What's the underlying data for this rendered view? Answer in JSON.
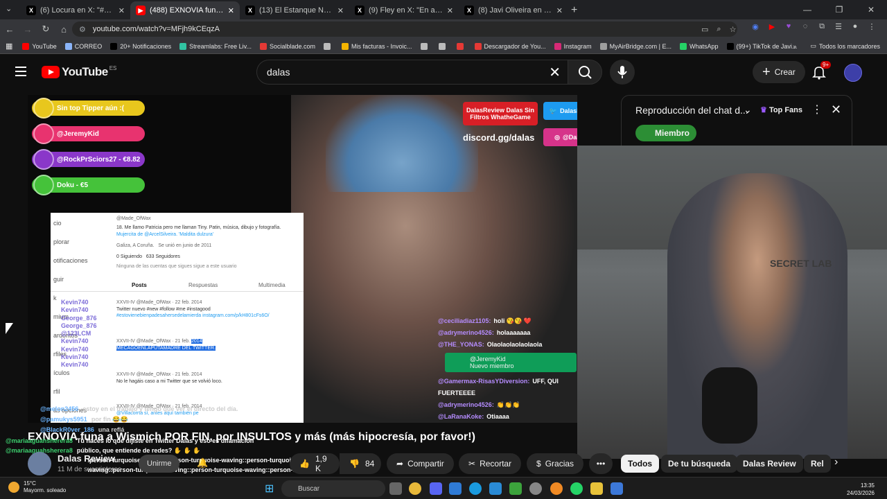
{
  "browser": {
    "tabs": [
      {
        "label": "(6) Locura en X: \"#CárcelGemel",
        "favicon": "X",
        "color": "#000"
      },
      {
        "label": "(488) EXNOVIA funa a Wismich",
        "favicon": "▶",
        "color": "#ff0000"
      },
      {
        "label": "(13) El Estanque News en X:",
        "favicon": "X",
        "color": "#000"
      },
      {
        "label": "(9) Fley en X: \"En algunos afirm",
        "favicon": "X",
        "color": "#000"
      },
      {
        "label": "(8) Javi Oliveira en X: \"Una ex p",
        "favicon": "X",
        "color": "#000"
      }
    ],
    "new_tab": "+",
    "url": "youtube.com/watch?v=MFjh9kCEqzA",
    "bookmarks": [
      {
        "label": "YouTube",
        "color": "#ff0000"
      },
      {
        "label": "CORREO",
        "color": "#8ab4f8"
      },
      {
        "label": "20+ Notificaciones",
        "color": "#000000"
      },
      {
        "label": "Streamlabs: Free Liv...",
        "color": "#31c3a2"
      },
      {
        "label": "Socialblade.com",
        "color": "#e53935"
      },
      {
        "label": "",
        "color": "#bbbbbb"
      },
      {
        "label": "Mis facturas - Invoic...",
        "color": "#f4b400"
      },
      {
        "label": "",
        "color": "#bbbbbb"
      },
      {
        "label": "",
        "color": "#bbbbbb"
      },
      {
        "label": "",
        "color": "#e53935"
      },
      {
        "label": "Descargador de You...",
        "color": "#e53935"
      },
      {
        "label": "Instagram",
        "color": "#d62976"
      },
      {
        "label": "MyAirBridge.com | E...",
        "color": "#9e9e9e"
      },
      {
        "label": "WhatsApp",
        "color": "#25d366"
      },
      {
        "label": "(99+) TikTok de Javi...",
        "color": "#000000"
      }
    ],
    "bookmarks_more": "»",
    "all_bookmarks": "Todos los marcadores"
  },
  "youtube": {
    "logo_text": "YouTube",
    "region": "ES",
    "search_value": "dalas",
    "create_label": "Crear",
    "notif_badge": "9+"
  },
  "video": {
    "overlay_alerts": [
      {
        "text": "Sin top Tipper aún :(",
        "color": "#e8c71d"
      },
      {
        "text": "@JeremyKid",
        "color": "#e8336f"
      },
      {
        "text": "@RockPrSciors27 - €8.82",
        "color": "#8a37c9"
      },
      {
        "text": "Doku - €5",
        "color": "#45c23a"
      }
    ],
    "socials": {
      "dalas_review": "DalasReview Dalas Sin Filtros WhatheGame",
      "twitter": "DalasReview",
      "discord": "discord.gg/dalas",
      "instagram": "@Dalasito"
    },
    "tweet_panel": {
      "handle": "@Made_OfWax",
      "bio_line1": "18. Me llamo Patricia pero me llaman Tiny. Patin, música, dibujo y fotografía.",
      "bio_line2": "Mujercita de @ArcelSilveira. 'Maldita dulzura'",
      "location": "Galiza, A Coruña.",
      "joined": "Se unió en junio de 2011",
      "following": "0 Siguiendo",
      "followers": "633 Seguidores",
      "nobody": "Ninguna de las cuentas que sigues sigue a este usuario",
      "tab_posts": "Posts",
      "tab_replies": "Respuestas",
      "tab_media": "Multimedia",
      "t1_head": "XXVII-IV @Made_OfWax · 22 feb. 2014",
      "t1_text": "Twitter nuevo #new #follow #me #instagood",
      "t1_text2": "#estovienebienpadesahersedelamierda instagram.com/p/kH801cFs6O/",
      "t2_head": "XXVII-IV @Made_OfWax · 21 feb.",
      "t2_year": "2014",
      "t2_text": "MECAGOENLAPUTAMADRE DEL TWITTER.",
      "t3_head": "XXVII-IV @Made_OfWax · 21 feb. 2014",
      "t3_text": "No le hagáis caso a mi Twitter que se volvió loco.",
      "t4_head": "XXVII-IV @Made_OfWax · 21 feb. 2014",
      "t4_text": "@Villacorrta sí, antes aquí también pe",
      "side_labels": [
        "cio",
        "plorar",
        "otificaciones",
        "guir",
        "k",
        "mium",
        "ardoritos",
        "rfiles",
        "ículos",
        "rfil",
        "ás opciones"
      ]
    },
    "kevin_list": [
      "Kevin740",
      "Kevin740",
      "George_876",
      "George_876",
      "@123LCM",
      "Kevin740",
      "Kevin740",
      "Kevin740",
      "Kevin740"
    ],
    "overlay_chat": [
      {
        "user": "@ceciliadiaz1105:",
        "msg": "holi 😘😘 ❤️"
      },
      {
        "user": "@adrymerino4526:",
        "msg": "holaaaaaaa"
      },
      {
        "user": "@THE_YONAS:",
        "msg": "Olaolaolaolaolaola"
      },
      {
        "user": "@Gamermax-RisasYDiversion:",
        "msg": "UFF, QUI FUERTEEEE"
      },
      {
        "user": "@adrymerino4526:",
        "msg": "👏👏👏"
      },
      {
        "user": "@LaRanaKoke:",
        "msg": "Otiaaaa"
      },
      {
        "user": "@88llerrx70:",
        "msg": "Te amo dalas"
      }
    ],
    "new_member": {
      "user": "@JeremyKid",
      "label": "Nuevo miembro"
    },
    "webcam_logo": "SECRET LAB",
    "bottom_chat": [
      {
        "user": "@melon2456",
        "msg": "estoy en el trabajo y tengo que ver el directo del día."
      },
      {
        "user": "@pamukys5951",
        "msg": "por fin 😂😂"
      },
      {
        "user": "@BlackR0ver_186",
        "msg": "una reflá"
      }
    ]
  },
  "live_chat_panel": {
    "title": "Reproducción del chat d...",
    "filter": "Top Fans",
    "member_chip": "Miembro"
  },
  "video_info": {
    "title": "EXNOVIA funa a Wismich POR FIN, por INSULTOS y más (más hipocresía, por favor!)",
    "channel": "Dalas Review",
    "subs": "11 M de suscriptores",
    "join": "Unirme",
    "likes": "1,9 K",
    "dislikes": "84",
    "share": "Compartir",
    "clip": "Recortar",
    "thanks": "Gracias",
    "more": "•••",
    "chat_overlay_lines": [
      {
        "user": "@mariaaguahsherera8",
        "msg": "Tú haces lo que dijiste en Twitter Dalas y eso es difamación"
      },
      {
        "user": "@mariaaguahsherera8",
        "msg": "público, que entiende de redes? ✋ ✋ ✋"
      },
      {
        "user": "",
        "msg": ":person-turquoise-waving::person-turquoise-waving::person-turquoise-"
      },
      {
        "user": "",
        "msg": "waving::person-turquoise-waving::person-turquoise-waving::person-turquoise-"
      },
      {
        "user": "",
        "msg": "waving::person-turquoise-waving:"
      }
    ]
  },
  "chips": [
    "Todos",
    "De tu búsqueda",
    "Dalas Review",
    "Rel"
  ],
  "taskbar": {
    "temp": "15°C",
    "weather": "Mayorm. soleado",
    "search": "Buscar",
    "time": "13:35",
    "date": "24/03/2026"
  }
}
